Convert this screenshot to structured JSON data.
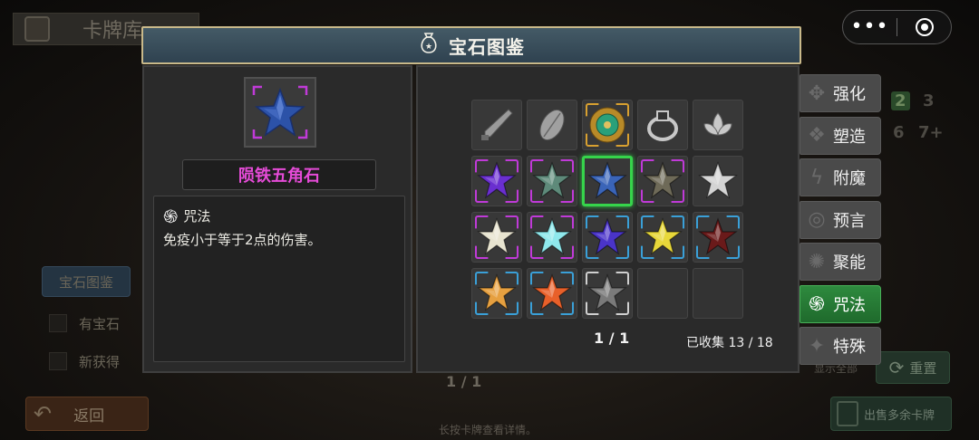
{
  "background": {
    "title": "卡牌库",
    "side_tab": "宝石图鉴",
    "filter_has_gem": "有宝石",
    "filter_new": "新获得",
    "back_label": "返回",
    "page": "1 / 1",
    "hint": "长按卡牌查看详情。",
    "show_all": "显示全部",
    "reset_label": "重置",
    "sell_label": "出售多余卡牌",
    "cost_numbers": [
      "2",
      "3",
      "6",
      "7+"
    ]
  },
  "capsule": {
    "more": "•••"
  },
  "modal": {
    "title": "宝石图鉴",
    "selected_gem": {
      "name": "陨铁五角石",
      "type_label": "咒法",
      "description": "免疫小于等于2点的伤害。"
    },
    "page_indicator": "1 / 1",
    "collected": "已收集 13 / 18",
    "items": [
      {
        "kind": "dagger",
        "frame": "none",
        "color": "#9a9a9a"
      },
      {
        "kind": "leaf",
        "frame": "none",
        "color": "#a0a0a0"
      },
      {
        "kind": "disc",
        "frame": "gold",
        "color": "#2aa07a"
      },
      {
        "kind": "ring",
        "frame": "none",
        "color": "#c8c8c8"
      },
      {
        "kind": "lotus",
        "frame": "none",
        "color": "#c8c8c8"
      },
      {
        "kind": "star",
        "frame": "purple",
        "color": "#6a2fd0"
      },
      {
        "kind": "star",
        "frame": "purple",
        "color": "#5e8a7a"
      },
      {
        "kind": "star",
        "frame": "selected",
        "color": "#3a64b8"
      },
      {
        "kind": "star",
        "frame": "purple",
        "color": "#6e6a58"
      },
      {
        "kind": "star",
        "frame": "none",
        "color": "#d4d4d4"
      },
      {
        "kind": "star",
        "frame": "purple",
        "color": "#e8e4d0"
      },
      {
        "kind": "star",
        "frame": "purple",
        "color": "#8fe8ec"
      },
      {
        "kind": "star",
        "frame": "blue",
        "color": "#4a34c8"
      },
      {
        "kind": "star",
        "frame": "blue",
        "color": "#e8d83a"
      },
      {
        "kind": "star",
        "frame": "blue",
        "color": "#6a1a1a"
      },
      {
        "kind": "star",
        "frame": "blue",
        "color": "#e6a040"
      },
      {
        "kind": "star",
        "frame": "blue",
        "color": "#e8602a"
      },
      {
        "kind": "star",
        "frame": "white",
        "color": "#7a7a7a"
      },
      {
        "kind": "empty",
        "frame": "none",
        "color": ""
      },
      {
        "kind": "empty",
        "frame": "none",
        "color": ""
      }
    ]
  },
  "tabs": [
    {
      "label": "强化",
      "icon": "✥",
      "active": false
    },
    {
      "label": "塑造",
      "icon": "❖",
      "active": false
    },
    {
      "label": "附魔",
      "icon": "ϟ",
      "active": false
    },
    {
      "label": "预言",
      "icon": "◎",
      "active": false
    },
    {
      "label": "聚能",
      "icon": "✺",
      "active": false
    },
    {
      "label": "咒法",
      "icon": "֍",
      "active": true
    },
    {
      "label": "特殊",
      "icon": "✦",
      "active": false
    }
  ],
  "colors": {
    "selected_name": "#e64bd8",
    "frame_purple": "#c03ad8",
    "frame_blue": "#3aa0d8",
    "frame_gold": "#d8a030",
    "frame_white": "#d0d0d0",
    "selected_green": "#36d44b",
    "active_tab": "#2e8a3e"
  }
}
